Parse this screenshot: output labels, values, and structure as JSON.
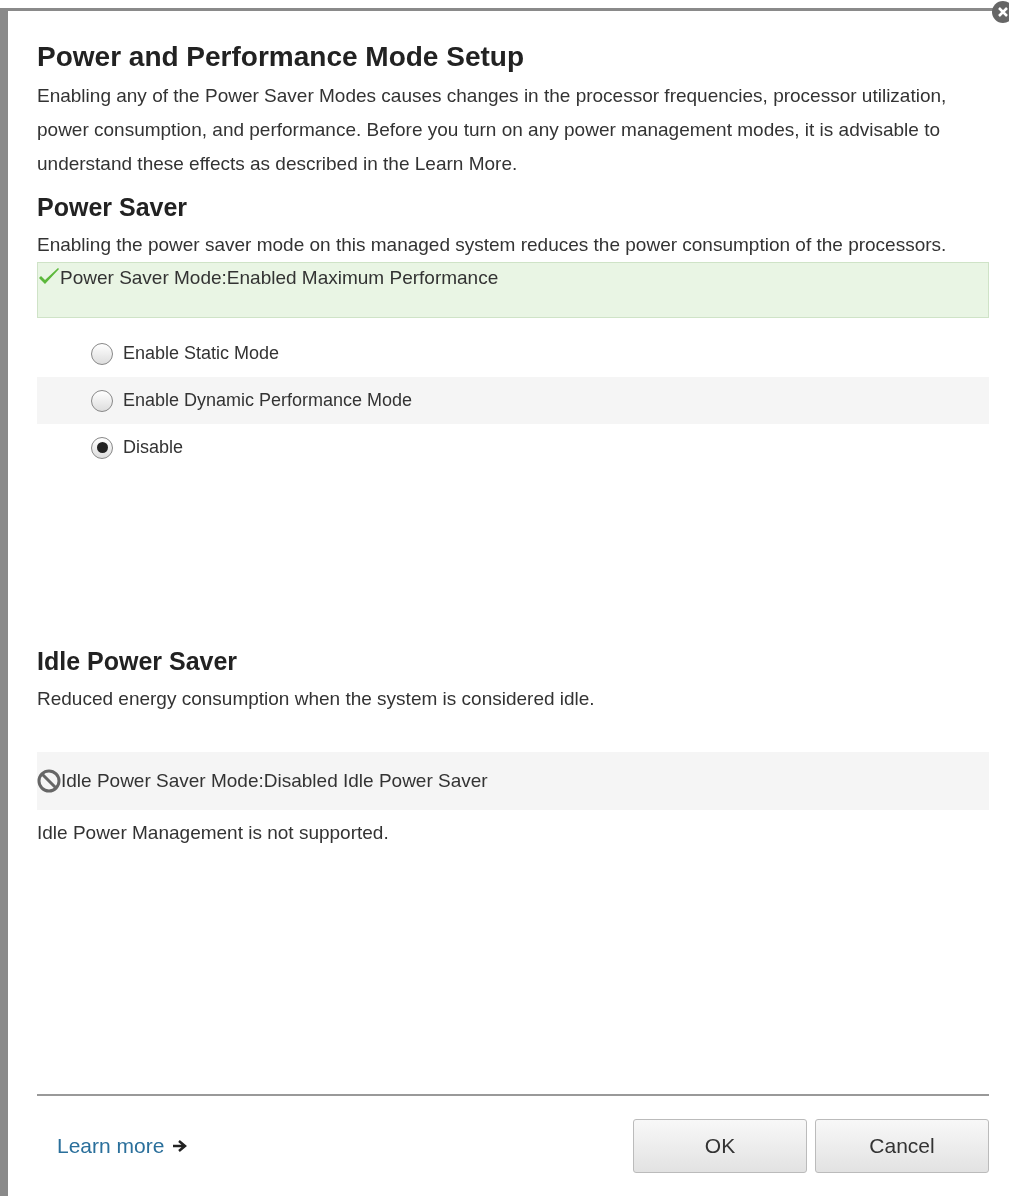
{
  "dialog": {
    "title": "Power and Performance Mode Setup",
    "intro": "Enabling any of the Power Saver Modes causes changes in the processor frequencies, processor utilization, power consumption, and performance. Before you turn on any power management modes, it is advisable to understand these effects as described in the Learn More."
  },
  "power_saver": {
    "heading": "Power Saver",
    "description": "Enabling the power saver mode on this managed system reduces the power consumption of the processors.",
    "status": {
      "kind": "success",
      "text": "Power Saver Mode:Enabled Maximum Performance"
    },
    "options": [
      {
        "label": "Enable Static Mode",
        "selected": false
      },
      {
        "label": "Enable Dynamic Performance Mode",
        "selected": false
      },
      {
        "label": "Disable",
        "selected": true
      }
    ]
  },
  "idle_power_saver": {
    "heading": "Idle Power Saver",
    "description": "Reduced energy consumption when the system is considered idle.",
    "status": {
      "kind": "disabled",
      "text": "Idle Power Saver Mode:Disabled Idle Power Saver"
    },
    "note": "Idle Power Management is not supported."
  },
  "footer": {
    "link": "Learn more",
    "buttons": [
      "OK",
      "Cancel"
    ]
  }
}
